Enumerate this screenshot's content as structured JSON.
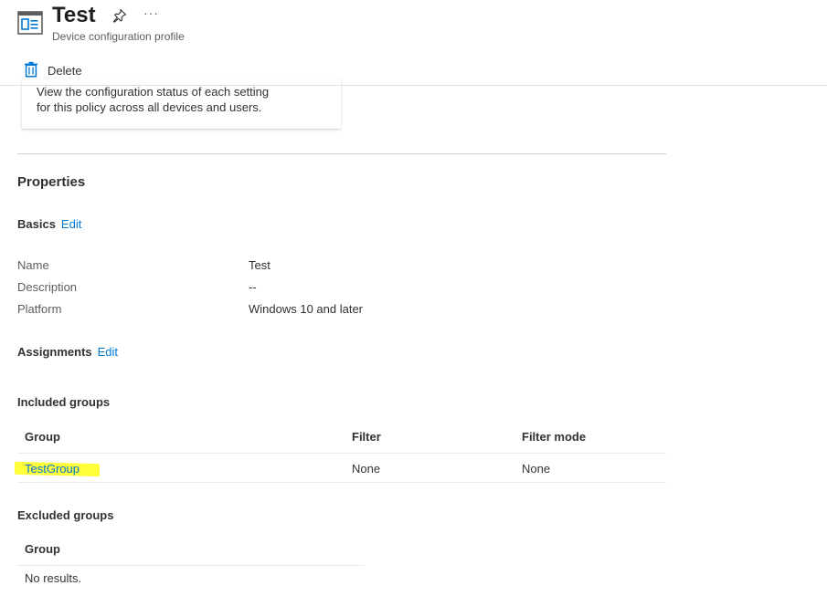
{
  "header": {
    "title": "Test",
    "more_label": "···",
    "subtitle": "Device configuration profile"
  },
  "toolbar": {
    "delete_label": "Delete"
  },
  "card": {
    "line1": "View the configuration status of each setting",
    "line2": "for this policy across all devices and users."
  },
  "properties": {
    "heading": "Properties",
    "basics": {
      "label": "Basics",
      "edit": "Edit",
      "rows": [
        {
          "key": "Name",
          "value": "Test"
        },
        {
          "key": "Description",
          "value": "--"
        },
        {
          "key": "Platform",
          "value": "Windows 10 and later"
        }
      ]
    },
    "assignments": {
      "label": "Assignments",
      "edit": "Edit"
    },
    "included": {
      "heading": "Included groups",
      "columns": [
        "Group",
        "Filter",
        "Filter mode"
      ],
      "rows": [
        {
          "group": "TestGroup",
          "filter": "None",
          "filter_mode": "None"
        }
      ]
    },
    "excluded": {
      "heading": "Excluded groups",
      "columns": [
        "Group"
      ],
      "empty": "No results."
    }
  },
  "colors": {
    "link": "#0078d4",
    "highlight": "#ffff3a",
    "text": "#323130"
  },
  "icons": {
    "page": "profile-window-icon",
    "pin": "pin-icon",
    "delete": "trash-icon"
  }
}
